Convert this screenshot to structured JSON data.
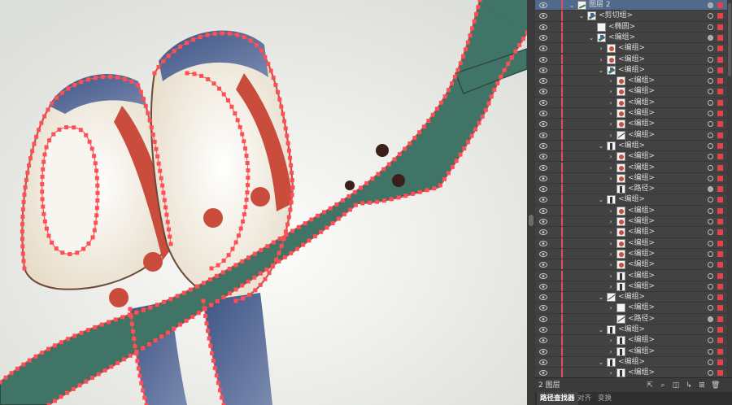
{
  "layers_panel": {
    "rows": [
      {
        "label": "图层 2",
        "indent": 0,
        "twirl": "v",
        "thumb": "layer",
        "target": "filled",
        "selected": true
      },
      {
        "label": "<剪切组>",
        "indent": 1,
        "twirl": "v",
        "thumb": "bird",
        "target": "empty",
        "selected": false
      },
      {
        "label": "<椭圆>",
        "indent": 2,
        "twirl": "",
        "thumb": "blank",
        "target": "empty",
        "selected": false
      },
      {
        "label": "<编组>",
        "indent": 2,
        "twirl": "v",
        "thumb": "bird",
        "target": "filled",
        "selected": false
      },
      {
        "label": "<编组>",
        "indent": 3,
        "twirl": ">",
        "thumb": "red",
        "target": "empty",
        "selected": false
      },
      {
        "label": "<编组>",
        "indent": 3,
        "twirl": ">",
        "thumb": "red",
        "target": "empty",
        "selected": false
      },
      {
        "label": "<编组>",
        "indent": 3,
        "twirl": "v",
        "thumb": "bird",
        "target": "empty",
        "selected": false
      },
      {
        "label": "<编组>",
        "indent": 4,
        "twirl": ">",
        "thumb": "red",
        "target": "empty",
        "selected": false
      },
      {
        "label": "<编组>",
        "indent": 4,
        "twirl": ">",
        "thumb": "red",
        "target": "empty",
        "selected": false
      },
      {
        "label": "<编组>",
        "indent": 4,
        "twirl": ">",
        "thumb": "red",
        "target": "empty",
        "selected": false
      },
      {
        "label": "<编组>",
        "indent": 4,
        "twirl": ">",
        "thumb": "red",
        "target": "empty",
        "selected": false
      },
      {
        "label": "<编组>",
        "indent": 4,
        "twirl": ">",
        "thumb": "red",
        "target": "empty",
        "selected": false
      },
      {
        "label": "<编组>",
        "indent": 4,
        "twirl": ">",
        "thumb": "line",
        "target": "empty",
        "selected": false
      },
      {
        "label": "<编组>",
        "indent": 3,
        "twirl": "v",
        "thumb": "dark",
        "target": "empty",
        "selected": false
      },
      {
        "label": "<编组>",
        "indent": 4,
        "twirl": ">",
        "thumb": "red",
        "target": "empty",
        "selected": false
      },
      {
        "label": "<编组>",
        "indent": 4,
        "twirl": ">",
        "thumb": "red",
        "target": "empty",
        "selected": false
      },
      {
        "label": "<编组>",
        "indent": 4,
        "twirl": ">",
        "thumb": "red",
        "target": "empty",
        "selected": false
      },
      {
        "label": "<路径>",
        "indent": 4,
        "twirl": "",
        "thumb": "dark",
        "target": "filled",
        "selected": false
      },
      {
        "label": "<编组>",
        "indent": 3,
        "twirl": "v",
        "thumb": "dark",
        "target": "empty",
        "selected": false
      },
      {
        "label": "<编组>",
        "indent": 4,
        "twirl": ">",
        "thumb": "red",
        "target": "empty",
        "selected": false
      },
      {
        "label": "<编组>",
        "indent": 4,
        "twirl": ">",
        "thumb": "red",
        "target": "empty",
        "selected": false
      },
      {
        "label": "<编组>",
        "indent": 4,
        "twirl": ">",
        "thumb": "red",
        "target": "empty",
        "selected": false
      },
      {
        "label": "<编组>",
        "indent": 4,
        "twirl": ">",
        "thumb": "red",
        "target": "empty",
        "selected": false
      },
      {
        "label": "<编组>",
        "indent": 4,
        "twirl": ">",
        "thumb": "red",
        "target": "empty",
        "selected": false
      },
      {
        "label": "<编组>",
        "indent": 4,
        "twirl": ">",
        "thumb": "red",
        "target": "empty",
        "selected": false
      },
      {
        "label": "<编组>",
        "indent": 4,
        "twirl": ">",
        "thumb": "dark",
        "target": "empty",
        "selected": false
      },
      {
        "label": "<编组>",
        "indent": 4,
        "twirl": ">",
        "thumb": "dark",
        "target": "empty",
        "selected": false
      },
      {
        "label": "<编组>",
        "indent": 3,
        "twirl": "v",
        "thumb": "line",
        "target": "empty",
        "selected": false
      },
      {
        "label": "<编组>",
        "indent": 4,
        "twirl": ">",
        "thumb": "blank",
        "target": "empty",
        "selected": false
      },
      {
        "label": "<路径>",
        "indent": 4,
        "twirl": "",
        "thumb": "line",
        "target": "filled",
        "selected": false
      },
      {
        "label": "<编组>",
        "indent": 3,
        "twirl": "v",
        "thumb": "dark",
        "target": "empty",
        "selected": false
      },
      {
        "label": "<编组>",
        "indent": 4,
        "twirl": ">",
        "thumb": "dark",
        "target": "empty",
        "selected": false
      },
      {
        "label": "<编组>",
        "indent": 4,
        "twirl": ">",
        "thumb": "dark",
        "target": "empty",
        "selected": false
      },
      {
        "label": "<编组>",
        "indent": 3,
        "twirl": "v",
        "thumb": "dark",
        "target": "empty",
        "selected": false
      },
      {
        "label": "<编组>",
        "indent": 4,
        "twirl": ">",
        "thumb": "dark",
        "target": "empty",
        "selected": false
      }
    ],
    "footer": {
      "count": "2 图层"
    },
    "footer_icons": [
      "export-icon",
      "search-icon",
      "clip-icon",
      "sublayer-icon",
      "new-layer-icon",
      "delete-icon"
    ],
    "tabs": [
      "路径查找器",
      "对齐",
      "变换"
    ],
    "active_tab": 0
  },
  "colors": {
    "branch": "#3f7466",
    "anchor": "#ff4f55",
    "panel_bg": "#424242",
    "selection": "#4f6a8a",
    "wing_blue": "#4b6290",
    "cream": "#efe9da"
  }
}
